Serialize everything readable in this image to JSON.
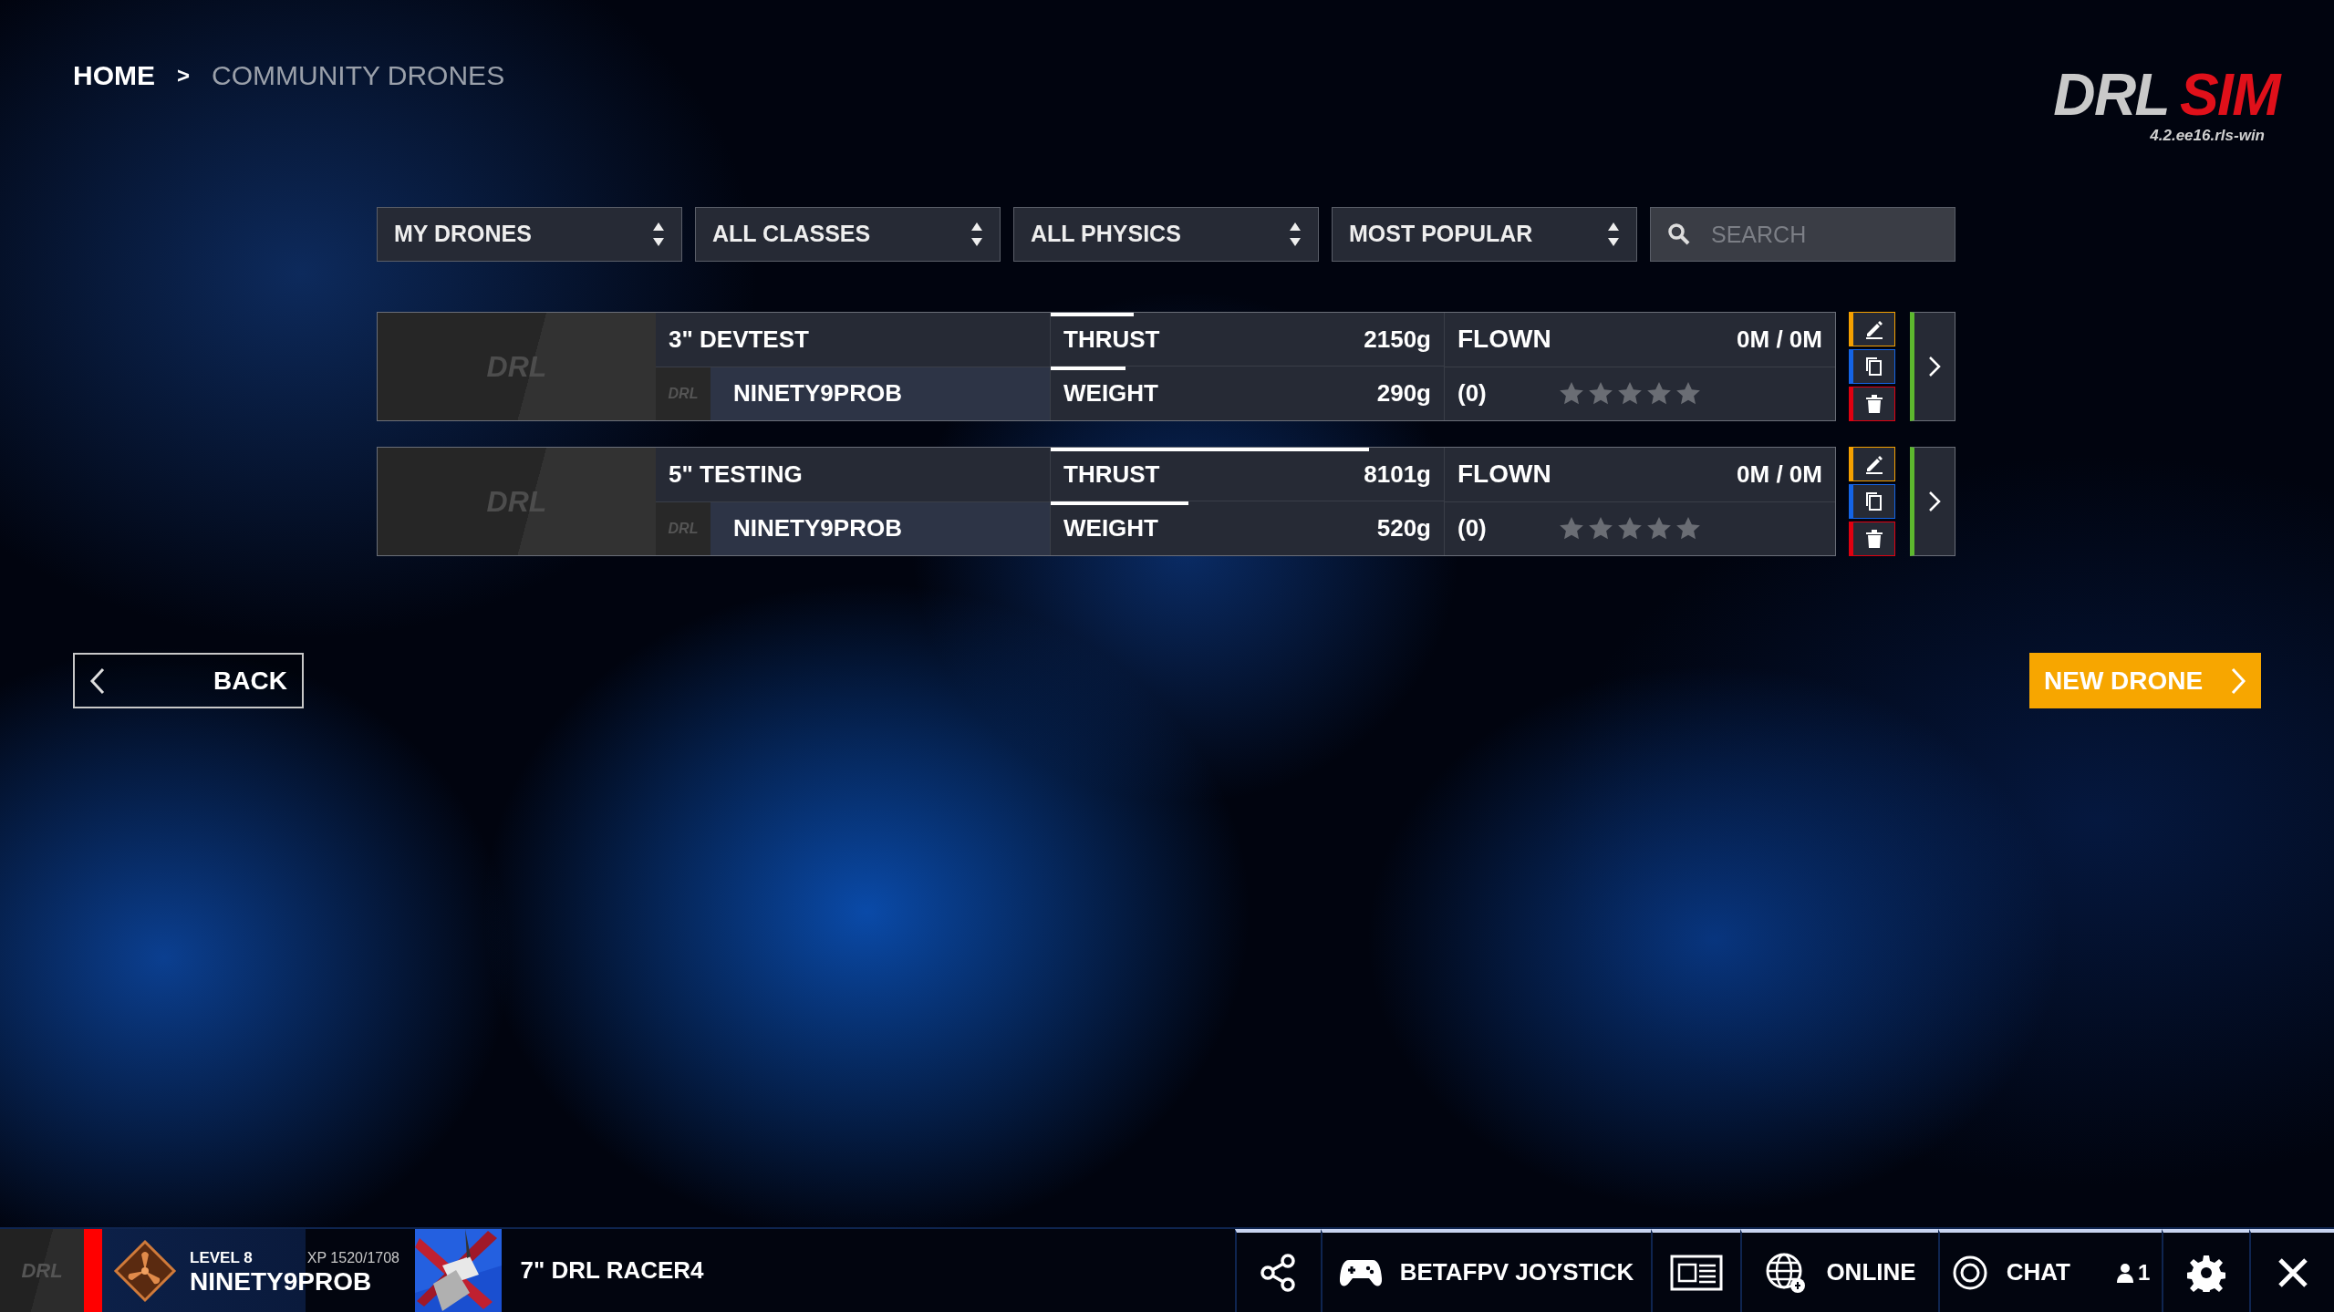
{
  "breadcrumb": {
    "separator": ">",
    "items": [
      {
        "label": "HOME",
        "current": false
      },
      {
        "label": "COMMUNITY DRONES",
        "current": true
      }
    ]
  },
  "logo": {
    "text_1": "DRL",
    "text_2": "SIM",
    "version": "4.2.ee16.rls-win"
  },
  "filters": [
    {
      "kind": "select",
      "value": "MY DRONES"
    },
    {
      "kind": "select",
      "value": "ALL CLASSES"
    },
    {
      "kind": "select",
      "value": "ALL PHYSICS"
    },
    {
      "kind": "select",
      "value": "MOST POPULAR"
    },
    {
      "kind": "search",
      "placeholder": "SEARCH"
    }
  ],
  "drones": [
    {
      "thumb_logo": "DRL",
      "name": "3\" DEVTEST",
      "author_logo": "DRL",
      "author": "NINETY9PROB",
      "stats": [
        {
          "label": "THRUST",
          "value": "2150g",
          "level": 0.21
        },
        {
          "label": "WEIGHT",
          "value": "290g",
          "level": 0.19
        }
      ],
      "flown_label": "FLOWN",
      "flown": "0M / 0M",
      "ratings": "(0)",
      "stars": 0
    },
    {
      "thumb_logo": "DRL",
      "name": "5\" TESTING",
      "author_logo": "DRL",
      "author": "NINETY9PROB",
      "stats": [
        {
          "label": "THRUST",
          "value": "8101g",
          "level": 0.81
        },
        {
          "label": "WEIGHT",
          "value": "520g",
          "level": 0.35
        }
      ],
      "flown_label": "FLOWN",
      "flown": "0M / 0M",
      "ratings": "(0)",
      "stars": 0
    }
  ],
  "back_button": "BACK",
  "new_drone_button": "NEW DRONE",
  "status_bar": {
    "logo": "DRL",
    "player": {
      "level": "LEVEL 8",
      "xp": "XP 1520/1708",
      "name": "NINETY9PROB"
    },
    "drone": "7\" DRL RACER4",
    "items": [
      {
        "kind": "share"
      },
      {
        "kind": "controller",
        "label": "BETAFPV JOYSTICK"
      },
      {
        "kind": "card"
      },
      {
        "kind": "online",
        "label": "ONLINE"
      },
      {
        "kind": "chat",
        "label": "CHAT",
        "count": "1"
      },
      {
        "kind": "settings"
      },
      {
        "kind": "close"
      }
    ]
  }
}
